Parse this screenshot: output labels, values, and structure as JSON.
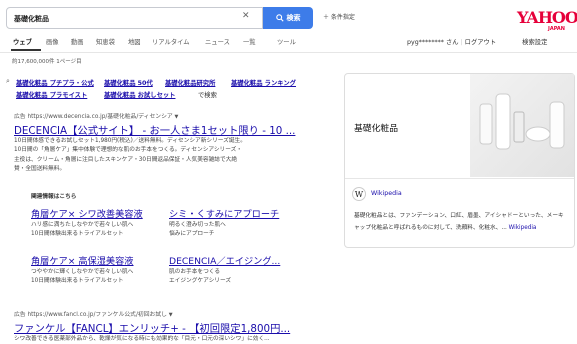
{
  "search": {
    "query": "基礎化粧品",
    "button_label": "検索",
    "condition_label": "＋ 条件指定"
  },
  "logo": {
    "text": "YAHOO!",
    "sub": "JAPAN"
  },
  "tabs": [
    "ウェブ",
    "画像",
    "動画",
    "知恵袋",
    "地図",
    "リアルタイム",
    "ニュース",
    "一覧",
    "ツール"
  ],
  "user": {
    "name": "pyg******** さん",
    "logout": "ログアウト",
    "settings": "検索設定"
  },
  "result_count": "約17,600,000件  1ページ目",
  "related": {
    "row1": [
      "基礎化粧品 プチプラ・公式",
      "基礎化粧品 50代",
      "基礎化粧品研究所",
      "基礎化粧品 ランキング"
    ],
    "row2": [
      "基礎化粧品 プラモイスト",
      "基礎化粧品 お試しセット"
    ],
    "suffix": "で検索"
  },
  "ad1": {
    "label": "広告",
    "url": "https://www.decencia.co.jp/基礎化粧品/ディセンシア",
    "title": "DECENCIA【公式サイト】 - お一人さま1セット限り - 10 ...",
    "desc": [
      "10日間体感できるお試しセット1,980円(税込)／送料無料。ディセンシア新シリーズ誕生。",
      "10日間の「角層ケア」集中体験で理想的な肌のお手本をつくる。ディセンシアシリーズ・",
      "主役は、クリーム・角層に注目したスキンケア・30日間返品保証・人気美容雑誌で大絶",
      "賛・全国送料無料。"
    ],
    "sitelinks_header": "関連情報はこちら",
    "sitelinks": [
      {
        "title": "角層ケア× シワ改善美容液",
        "desc": [
          "ハリ感に満ちたしなやかで若々しい肌へ",
          "10日間体験出来るトライアルセット"
        ]
      },
      {
        "title": "シミ・くすみにアプローチ",
        "desc": [
          "明るく澄み切った肌へ",
          "悩みにアプローチ"
        ]
      },
      {
        "title": "角層ケア× 高保湿美容液",
        "desc": [
          "つややかに輝くしなやかで若々しい肌へ",
          "10日間体験出来るトライアルセット"
        ]
      },
      {
        "title": "DECENCIA／エイジング...",
        "desc": [
          "肌のお手本をつくる",
          "エイジングケアシリーズ"
        ]
      }
    ]
  },
  "ad2": {
    "label": "広告",
    "url": "https://www.fancl.co.jp/ファンケル公式/初回お試し",
    "title": "ファンケル【FANCL】エンリッチ+ - 【初回限定1,800円...",
    "desc": "シワ改善できる医薬部外品から、乾燥が気になる時にも効果的な「目元・口元の深いシワ」に効く..."
  },
  "knowledge": {
    "title": "基礎化粧品",
    "source": "Wikipedia",
    "desc": "基礎化粧品とは、ファンデーション、口紅、眉墨、アイシャドーといった、メーキャップ化粧品と呼ばれるものに対して、洗顔料、化粧水、... ",
    "desc_link": "Wikipedia"
  }
}
